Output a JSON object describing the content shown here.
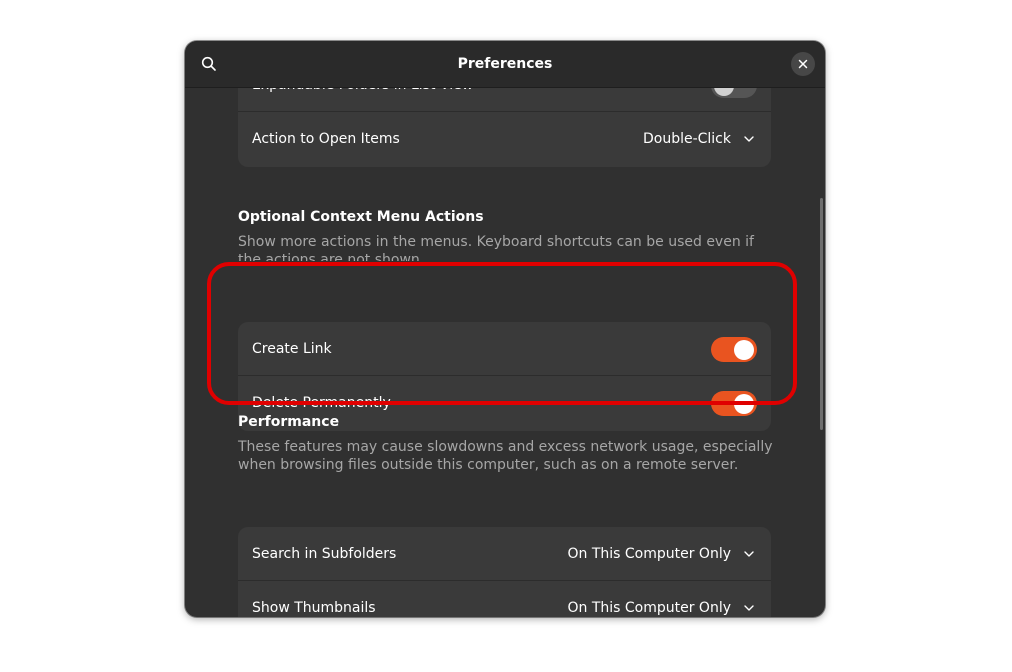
{
  "window": {
    "title": "Preferences"
  },
  "groups": {
    "general": {
      "expandable_folders": {
        "label": "Expandable Folders in List View",
        "enabled": false
      },
      "action_open": {
        "label": "Action to Open Items",
        "value": "Double-Click"
      }
    },
    "context": {
      "title": "Optional Context Menu Actions",
      "description": "Show more actions in the menus. Keyboard shortcuts can be used even if the actions are not shown.",
      "create_link": {
        "label": "Create Link",
        "enabled": true
      },
      "delete_permanently": {
        "label": "Delete Permanently",
        "enabled": true
      }
    },
    "performance": {
      "title": "Performance",
      "description": "These features may cause slowdowns and excess network usage, especially when browsing files outside this computer, such as on a remote server.",
      "search_subfolders": {
        "label": "Search in Subfolders",
        "value": "On This Computer Only"
      },
      "show_thumbnails": {
        "label": "Show Thumbnails",
        "value": "On This Computer Only"
      }
    }
  },
  "colors": {
    "accent": "#e95420",
    "highlight": "#e00000",
    "window_bg": "#303030",
    "row_bg": "#3a3a3a"
  },
  "icons": {
    "search": "search-icon",
    "close": "close-icon",
    "chevron": "chevron-down-icon"
  }
}
